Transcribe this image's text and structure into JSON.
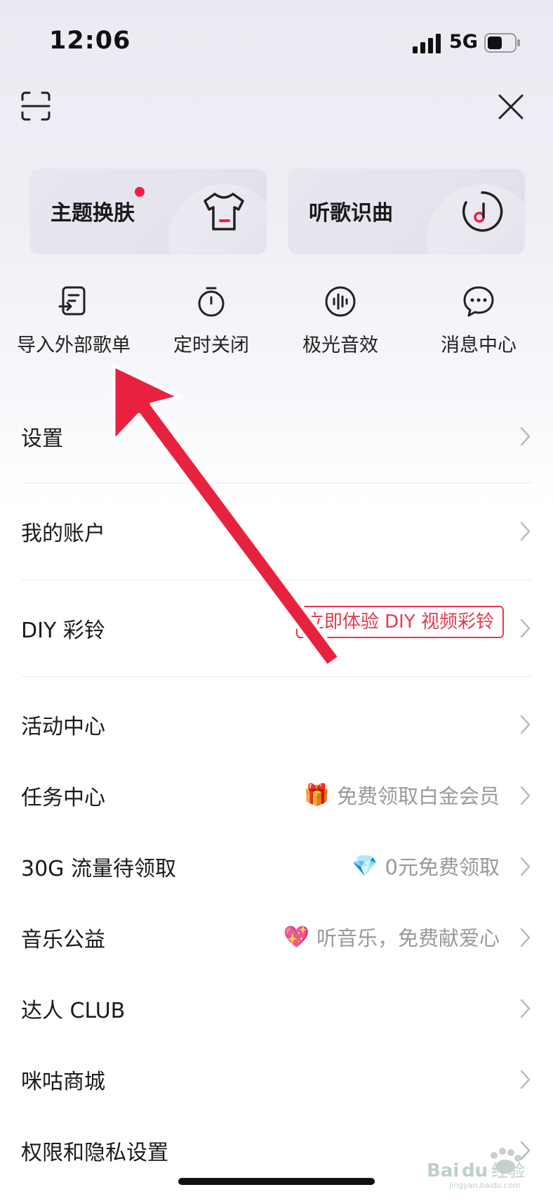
{
  "status": {
    "time": "12:06",
    "network": "5G"
  },
  "cards": [
    {
      "label": "主题换肤",
      "icon": "tshirt-icon",
      "has_dot": true
    },
    {
      "label": "听歌识曲",
      "icon": "music-recognize-icon"
    }
  ],
  "quick_actions": [
    {
      "label": "导入外部歌单",
      "icon": "import-playlist-icon"
    },
    {
      "label": "定时关闭",
      "icon": "timer-icon"
    },
    {
      "label": "极光音效",
      "icon": "sound-wave-icon"
    },
    {
      "label": "消息中心",
      "icon": "message-icon"
    }
  ],
  "menu": [
    {
      "label": "设置"
    },
    {
      "label": "我的账户"
    },
    {
      "label": "DIY 彩铃",
      "badge": "立即体验 DIY 视频彩铃"
    },
    {
      "label": "活动中心"
    },
    {
      "label": "任务中心",
      "emoji": "🎁",
      "right_text": "免费领取白金会员"
    },
    {
      "label": "30G 流量待领取",
      "emoji": "💎",
      "right_text": "0元免费领取"
    },
    {
      "label": "音乐公益",
      "emoji": "💖",
      "right_text": "听音乐，免费献爱心"
    },
    {
      "label": "达人 CLUB"
    },
    {
      "label": "咪咕商城"
    },
    {
      "label": "权限和隐私设置"
    }
  ],
  "watermark": {
    "brand": "Baidu经验",
    "url": "jingyan.baidu.com"
  },
  "colors": {
    "accent": "#ef1f45",
    "annotation_arrow": "#e8223e",
    "badge": "#e8384f"
  }
}
